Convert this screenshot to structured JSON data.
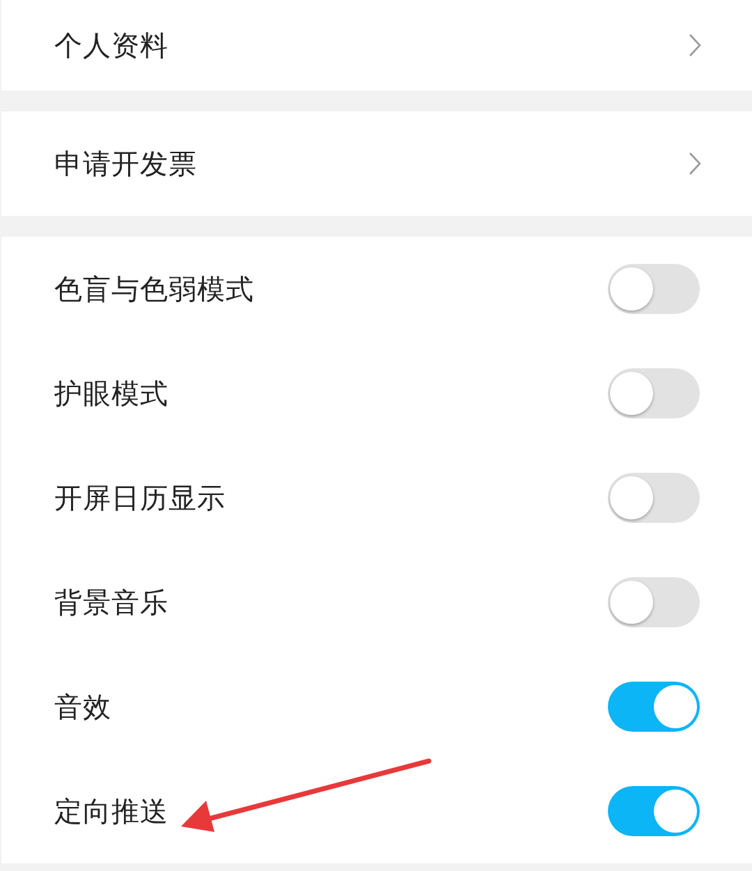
{
  "sections": [
    {
      "rows": [
        {
          "kind": "link",
          "label": "个人资料"
        }
      ]
    },
    {
      "rows": [
        {
          "kind": "link",
          "label": "申请开发票"
        }
      ]
    },
    {
      "rows": [
        {
          "kind": "toggle",
          "label": "色盲与色弱模式",
          "on": false
        },
        {
          "kind": "toggle",
          "label": "护眼模式",
          "on": false
        },
        {
          "kind": "toggle",
          "label": "开屏日历显示",
          "on": false
        },
        {
          "kind": "toggle",
          "label": "背景音乐",
          "on": false
        },
        {
          "kind": "toggle",
          "label": "音效",
          "on": true
        },
        {
          "kind": "toggle",
          "label": "定向推送",
          "on": true
        }
      ]
    }
  ]
}
